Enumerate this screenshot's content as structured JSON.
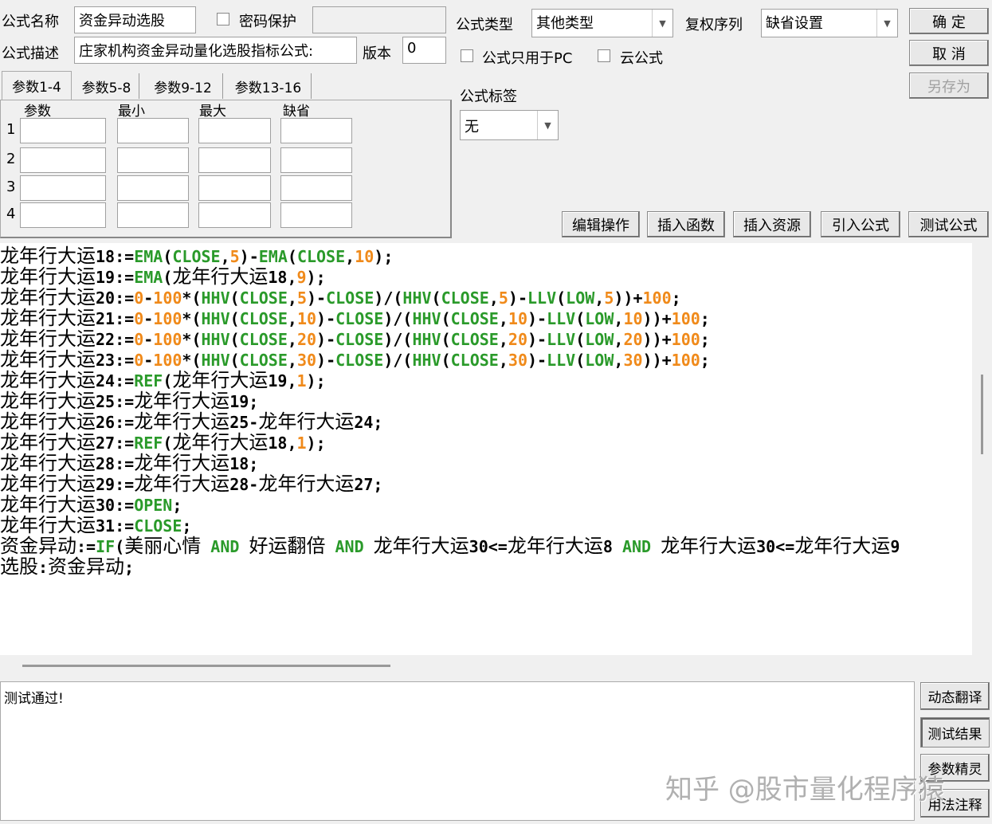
{
  "form": {
    "name_label": "公式名称",
    "name_value": "资金异动选股",
    "password_label": "密码保护",
    "desc_label": "公式描述",
    "desc_value": "庄家机构资金异动量化选股指标公式:",
    "version_label": "版本",
    "version_value": "0",
    "type_label": "公式类型",
    "type_value": "其他类型",
    "rights_label": "复权序列",
    "rights_value": "缺省设置",
    "pc_only_label": "公式只用于PC",
    "cloud_label": "云公式",
    "tag_label": "公式标签",
    "tag_value": "无"
  },
  "buttons": {
    "ok": "确 定",
    "cancel": "取 消",
    "save_as": "另存为",
    "edit": "编辑操作",
    "insert_func": "插入函数",
    "insert_res": "插入资源",
    "import": "引入公式",
    "test": "测试公式"
  },
  "tabs": [
    "参数1-4",
    "参数5-8",
    "参数9-12",
    "参数13-16"
  ],
  "params": {
    "headers": [
      "参数",
      "最小",
      "最大",
      "缺省"
    ],
    "rows": [
      "1",
      "2",
      "3",
      "4"
    ]
  },
  "code": [
    "龙年行大运18:=EMA(CLOSE,5)-EMA(CLOSE,10);",
    "龙年行大运19:=EMA(龙年行大运18,9);",
    "龙年行大运20:=0-100*(HHV(CLOSE,5)-CLOSE)/(HHV(CLOSE,5)-LLV(LOW,5))+100;",
    "龙年行大运21:=0-100*(HHV(CLOSE,10)-CLOSE)/(HHV(CLOSE,10)-LLV(LOW,10))+100;",
    "龙年行大运22:=0-100*(HHV(CLOSE,20)-CLOSE)/(HHV(CLOSE,20)-LLV(LOW,20))+100;",
    "龙年行大运23:=0-100*(HHV(CLOSE,30)-CLOSE)/(HHV(CLOSE,30)-LLV(LOW,30))+100;",
    "龙年行大运24:=REF(龙年行大运19,1);",
    "龙年行大运25:=龙年行大运19;",
    "龙年行大运26:=龙年行大运25-龙年行大运24;",
    "龙年行大运27:=REF(龙年行大运18,1);",
    "龙年行大运28:=龙年行大运18;",
    "龙年行大运29:=龙年行大运28-龙年行大运27;",
    "龙年行大运30:=OPEN;",
    "龙年行大运31:=CLOSE;",
    "资金异动:=IF(美丽心情 AND 好运翻倍 AND 龙年行大运30<=龙年行大运8 AND 龙年行大运30<=龙年行大运9",
    "选股:资金异动;"
  ],
  "output": {
    "message": "测试通过!"
  },
  "side_buttons": [
    "动态翻译",
    "测试结果",
    "参数精灵",
    "用法注释"
  ],
  "watermark": "知乎 @股市量化程序猿",
  "colors": {
    "keyword": "#2a9a2a",
    "number": "#f08a1a"
  }
}
